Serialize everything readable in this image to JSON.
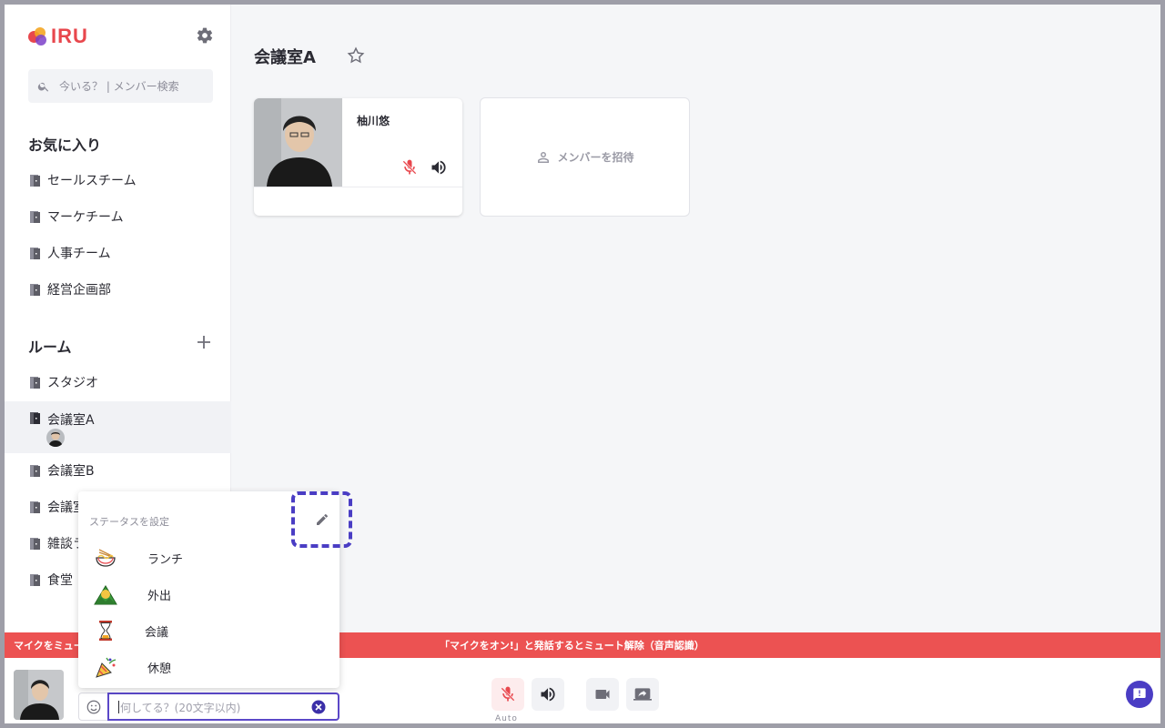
{
  "app": {
    "logo_text": "IRU",
    "brand_color": "#e8474d",
    "accent_color": "#4a3dc4"
  },
  "sidebar": {
    "search_placeholder": "今いる？ | メンバー検索",
    "favorites_title": "お気に入り",
    "favorites": [
      {
        "label": "セールスチーム"
      },
      {
        "label": "マーケチーム"
      },
      {
        "label": "人事チーム"
      },
      {
        "label": "経営企画部"
      }
    ],
    "rooms_title": "ルーム",
    "rooms": [
      {
        "label": "スタジオ"
      },
      {
        "label": "会議室A",
        "active": true
      },
      {
        "label": "会議室B"
      },
      {
        "label": "会議室"
      },
      {
        "label": "雑談ラ"
      },
      {
        "label": "食堂"
      }
    ]
  },
  "main": {
    "room_title": "会議室A",
    "members": [
      {
        "name": "柚川悠",
        "mic": "muted",
        "speaker": "on"
      }
    ],
    "invite_label": "メンバーを招待"
  },
  "banner": {
    "left_text": "マイクをミュー",
    "center_text": "「マイクをオン!」と発話するとミュート解除（音声認識）",
    "color": "#ec5252"
  },
  "status_popup": {
    "title": "ステータスを設定",
    "items": [
      {
        "label": "ランチ",
        "icon": "ramen-icon"
      },
      {
        "label": "外出",
        "icon": "mountain-icon"
      },
      {
        "label": "会議",
        "icon": "hourglass-icon"
      },
      {
        "label": "休憩",
        "icon": "party-popper-icon"
      }
    ]
  },
  "bottombar": {
    "status_placeholder": "何してる？(20文字以内)",
    "mic_mode": "Auto"
  }
}
